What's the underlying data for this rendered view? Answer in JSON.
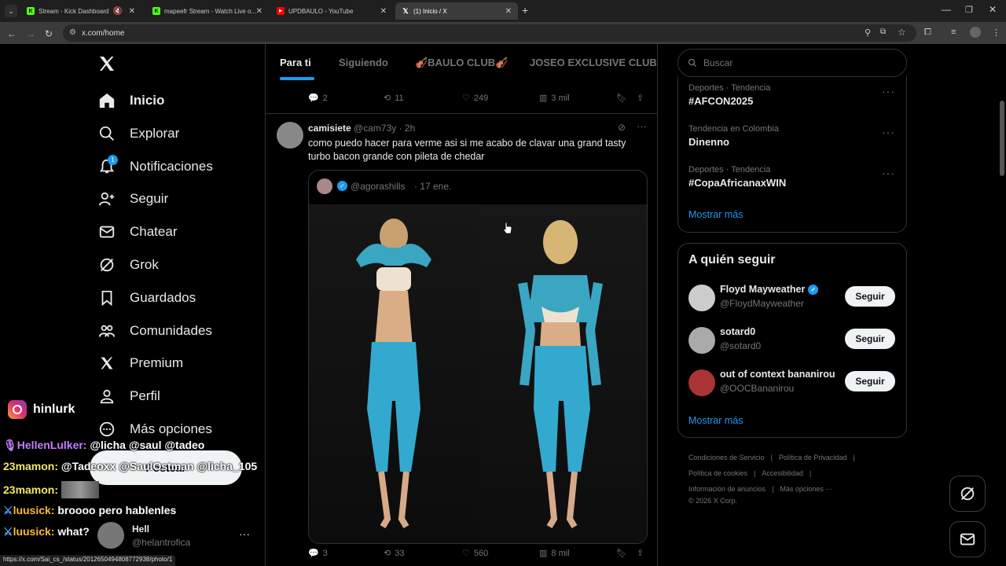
{
  "tabs": [
    {
      "label": "Stream - Kick Dashboard",
      "color": "#53fc18",
      "glyph": "K"
    },
    {
      "label": "mapeefr Stream - Watch Live o...",
      "color": "#53fc18",
      "glyph": "K"
    },
    {
      "label": "UPDBAULO - YouTube",
      "color": "#ff0000",
      "glyph": "▶"
    },
    {
      "label": "(1) Inicio / X",
      "color": "#ffffff",
      "glyph": "𝕏"
    }
  ],
  "url": "x.com/home",
  "nav": {
    "items": [
      {
        "label": "Inicio",
        "icon": "home-icon"
      },
      {
        "label": "Explorar",
        "icon": "search-icon"
      },
      {
        "label": "Notificaciones",
        "icon": "bell-icon",
        "badge": "1"
      },
      {
        "label": "Seguir",
        "icon": "add-user-icon"
      },
      {
        "label": "Chatear",
        "icon": "mail-icon"
      },
      {
        "label": "Grok",
        "icon": "grok-icon"
      },
      {
        "label": "Guardados",
        "icon": "bookmark-icon"
      },
      {
        "label": "Comunidades",
        "icon": "communities-icon"
      },
      {
        "label": "Premium",
        "icon": "x-logo-icon"
      },
      {
        "label": "Perfil",
        "icon": "person-icon"
      },
      {
        "label": "Más opciones",
        "icon": "more-icon"
      }
    ],
    "post_button": "Postear"
  },
  "account": {
    "name": "Hell",
    "handle": "@helantrofica"
  },
  "feed_tabs": [
    "Para ti",
    "Siguiendo",
    "🎻BAULO CLUB🎻",
    "JOSEO EXCLUSIVE CLUB"
  ],
  "prev_post_actions": {
    "replies": "2",
    "reposts": "11",
    "likes": "249",
    "views": "3 mil"
  },
  "post": {
    "author": "camisiete",
    "handle": "@cam73y",
    "time": "· 2h",
    "text_line1": "como puedo hacer para verme asi si me acabo de clavar una grand tasty",
    "text_line2": "turbo bacon grande con pileta de chedar",
    "quote_handle": "@agorashills",
    "quote_time": "· 17 ene.",
    "actions": {
      "replies": "3",
      "reposts": "33",
      "likes": "560",
      "views": "8 mil"
    }
  },
  "search": {
    "placeholder": "Buscar"
  },
  "trends": [
    {
      "meta": "Deportes · Tendencia",
      "title": "#AFCON2025"
    },
    {
      "meta": "Tendencia en Colombia",
      "title": "Dinenno"
    },
    {
      "meta": "Deportes · Tendencia",
      "title": "#CopaAfricanaxWIN"
    }
  ],
  "trends_more": "Mostrar más",
  "who_to_follow": {
    "title": "A quién seguir",
    "users": [
      {
        "name": "Floyd Mayweather",
        "handle": "@FloydMayweather",
        "verified": true
      },
      {
        "name": "sotard0",
        "handle": "@sotard0",
        "verified": false
      },
      {
        "name": "out of context bananirou",
        "handle": "@OOCBananirou",
        "verified": false
      }
    ],
    "follow_label": "Seguir",
    "more": "Mostrar más"
  },
  "footer": {
    "l1": "Condiciones de Servicio",
    "l2": "Política de Privacidad",
    "l3": "Política de cookies",
    "l4": "Accesibilidad",
    "l5": "Información de anuncios",
    "l6": "Más opciones ···",
    "copyright": "© 2026 X Corp."
  },
  "status_url": "https://x.com/Sai_cs_/status/2012650494808772938/photo/1",
  "overlay": {
    "instagram": "hinlurk",
    "chat": [
      {
        "user": "HellenLulker:",
        "msg": "@licha @saul @tadeo",
        "color": "#c77dff"
      },
      {
        "user": "23mamon:",
        "msg": "@Tadeoxx @SaulOstman @licha_105",
        "color": "#f5e663"
      },
      {
        "user": "23mamon:",
        "msg": "",
        "color": "#f5e663"
      },
      {
        "user": "luusick:",
        "msg": "broooo pero hablenles",
        "color": "#ffb830"
      },
      {
        "user": "luusick:",
        "msg": "what?",
        "color": "#ffb830"
      }
    ]
  },
  "colors": {
    "accent": "#1d9bf0",
    "bg": "#000000",
    "border": "#2f3336",
    "muted": "#71767b"
  }
}
